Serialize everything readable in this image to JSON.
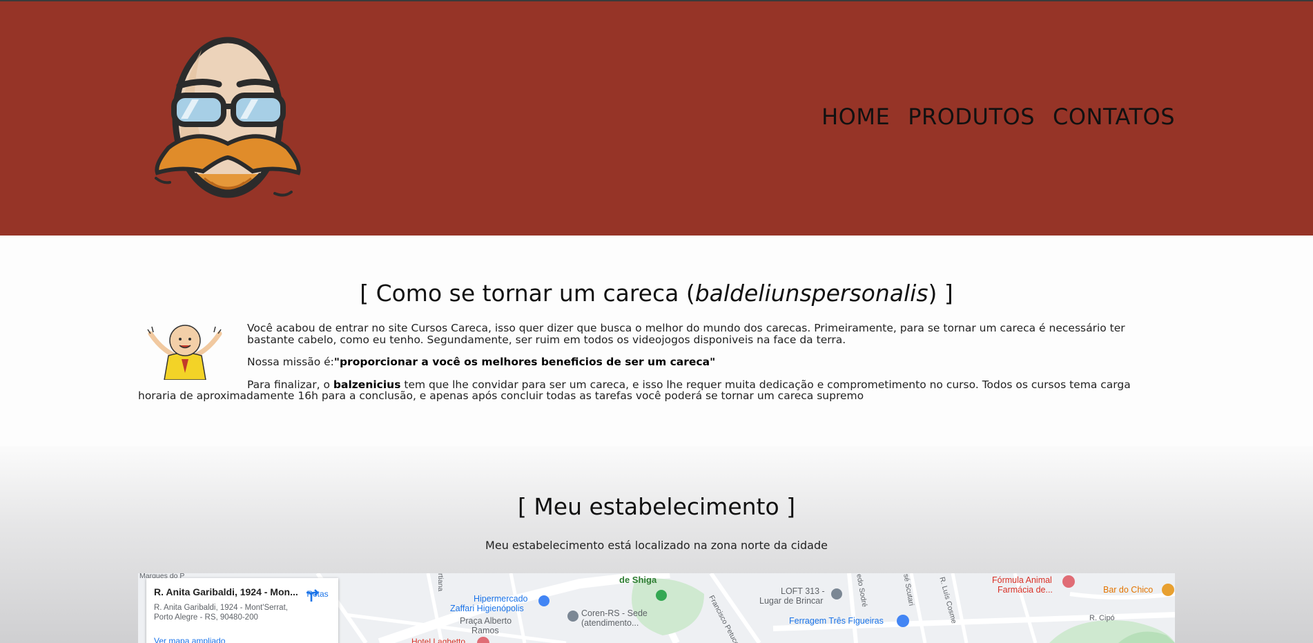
{
  "nav": {
    "home": "HOME",
    "produtos": "PRODUTOS",
    "contatos": "CONTATOS"
  },
  "about": {
    "title_pre": "[ Como se tornar um careca (",
    "title_em": "baldeliunspersonalis",
    "title_post": ") ]",
    "p1": "Você acabou de entrar no site Cursos Careca, isso quer dizer que busca o melhor do mundo dos carecas. Primeiramente, para se tornar um careca é necessário ter bastante cabelo, como eu tenho. Segundamente, ser ruim em todos os videojogos disponiveis na face da terra.",
    "mission_label": "Nossa missão é:",
    "mission": "\"proporcionar a você os melhores beneficios de ser um careca\"",
    "p3_pre": "Para finalizar, o ",
    "p3_name": "balzenicius",
    "p3_post": " tem que lhe convidar para ser um careca, e isso lhe requer muita dedicação e comprometimento no curso. Todos os cursos tema carga horaria de aproximadamente 16h para a conclusão, e apenas após concluir todas as tarefas você poderá se tornar um careca supremo"
  },
  "location": {
    "title": "[ Meu estabelecimento ]",
    "subtitle": "Meu estabelecimento está localizado na zona norte da cidade"
  },
  "map": {
    "card_title": "R. Anita Garibaldi, 1924 - Mon...",
    "card_address_1": "R. Anita Garibaldi, 1924 - Mont'Serrat,",
    "card_address_2": "Porto Alegre - RS, 90480-200",
    "card_link": "Ver mapa ampliado",
    "directions": "Rotas",
    "labels": {
      "shiga": "de Shiga",
      "hipermercado_1": "Hipermercado",
      "hipermercado_2": "Zaffari Higienópolis",
      "coren_1": "Coren-RS - Sede",
      "coren_2": "(atendimento...",
      "praca_1": "Praça Alberto",
      "praca_2": "Ramos",
      "loft_1": "LOFT 313 -",
      "loft_2": "Lugar de Brincar",
      "ferragem": "Ferragem Três Figueiras",
      "formula_1": "Fórmula Animal",
      "formula_2": "Farmácia de...",
      "bar": "Bar do Chico",
      "cipo": "R. Cipó",
      "marques": "Marques do P",
      "francisco": "Francisco Petuco",
      "luis_cosme": "R. Luís Cosme",
      "scutari": "sé Scutari",
      "sodre": "edo Sodré",
      "tiana": "rtiana",
      "hotel": "Hotel Laghetto"
    }
  }
}
